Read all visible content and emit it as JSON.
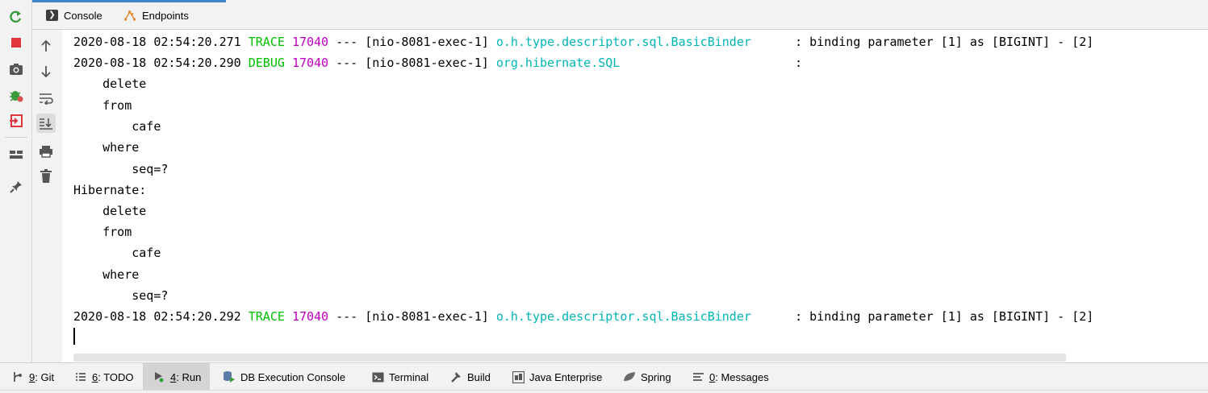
{
  "tabs": [
    {
      "label": "Console",
      "icon": "console-icon"
    },
    {
      "label": "Endpoints",
      "icon": "endpoints-icon"
    }
  ],
  "colors": {
    "trace": "#00c000",
    "debug": "#00c000",
    "pid": "#c000c0",
    "logger": "#00b5b5",
    "accent": "#4083c9"
  },
  "console": {
    "line1": {
      "ts": "2020-08-18 02:54:20.271 ",
      "level": "TRACE",
      "pid": "17040",
      "thread": " --- [nio-8081-exec-1] ",
      "logger": "o.h.type.descriptor.sql.BasicBinder     ",
      "msg": " : binding parameter [1] as [BIGINT] - [2]"
    },
    "line2": {
      "ts": "2020-08-18 02:54:20.290 ",
      "level": "DEBUG",
      "pid": "17040",
      "thread": " --- [nio-8081-exec-1] ",
      "logger": "org.hibernate.SQL                       ",
      "msg": " :"
    },
    "sql1": [
      "    delete",
      "    from",
      "        cafe",
      "    where",
      "        seq=?"
    ],
    "hibernate_label": "Hibernate:",
    "sql2": [
      "    delete",
      "    from",
      "        cafe",
      "    where",
      "        seq=?"
    ],
    "line3": {
      "ts": "2020-08-18 02:54:20.292 ",
      "level": "TRACE",
      "pid": "17040",
      "thread": " --- [nio-8081-exec-1] ",
      "logger": "o.h.type.descriptor.sql.BasicBinder     ",
      "msg": " : binding parameter [1] as [BIGINT] - [2]"
    }
  },
  "bottom_tools": [
    {
      "num": "9",
      "label": ": Git",
      "icon": "git-icon"
    },
    {
      "num": "6",
      "label": ": TODO",
      "icon": "todo-icon"
    },
    {
      "num": "4",
      "label": ": Run",
      "icon": "run-icon"
    },
    {
      "num": "",
      "label": "DB Execution Console",
      "icon": "db-console-icon"
    },
    {
      "num": "",
      "label": "Terminal",
      "icon": "terminal-icon"
    },
    {
      "num": "",
      "label": "Build",
      "icon": "build-icon"
    },
    {
      "num": "",
      "label": "Java Enterprise",
      "icon": "java-enterprise-icon"
    },
    {
      "num": "",
      "label": "Spring",
      "icon": "spring-icon"
    },
    {
      "num": "0",
      "label": ": Messages",
      "icon": "messages-icon"
    }
  ]
}
